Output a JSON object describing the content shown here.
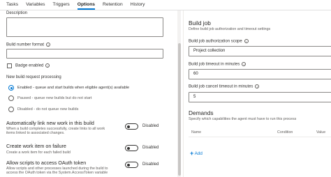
{
  "tabs": [
    "Tasks",
    "Variables",
    "Triggers",
    "Options",
    "Retention",
    "History"
  ],
  "active_tab": "Options",
  "left": {
    "description_label": "Description",
    "build_number_format_label": "Build number format",
    "badge_enabled_label": "Badge enabled",
    "new_build_request_label": "New build request processing",
    "radio_options": [
      "Enabled - queue and start builds when eligible agent(s) available",
      "Paused - queue new builds but do not start",
      "Disabled - do not queue new builds"
    ],
    "auto_link": {
      "title": "Automatically link new work in this build",
      "hint": "When a build completes successfully, create links to all work items linked to associated changes.",
      "toggle_label": "Disabled"
    },
    "create_work_item": {
      "title": "Create work item on failure",
      "hint": "Create a work item for each failed build",
      "toggle_label": "Disabled"
    },
    "oauth": {
      "title": "Allow scripts to access OAuth token",
      "hint": "Allow scripts and other processes launched during the build to access the OAuth token via the System.AccessToken variable",
      "toggle_label": "Disabled"
    }
  },
  "right": {
    "build_job_title": "Build job",
    "build_job_hint": "Define build job authorization and timeout settings",
    "auth_scope_label": "Build job authorization scope",
    "auth_scope_value": "Project collection",
    "timeout_label": "Build job timeout in minutes",
    "timeout_value": "60",
    "cancel_timeout_label": "Build job cancel timeout in minutes",
    "cancel_timeout_value": "5",
    "demands_title": "Demands",
    "demands_hint": "Specify which capabilities the agent must have to run this process",
    "columns": [
      "Name",
      "Condition",
      "Value"
    ],
    "add_label": "Add"
  }
}
